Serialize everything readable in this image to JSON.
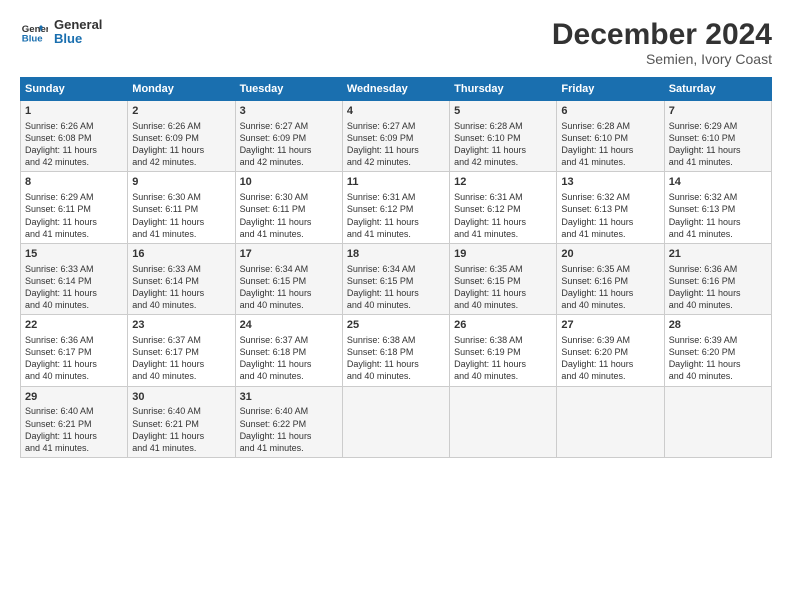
{
  "logo": {
    "line1": "General",
    "line2": "Blue"
  },
  "title": "December 2024",
  "subtitle": "Semien, Ivory Coast",
  "days_of_week": [
    "Sunday",
    "Monday",
    "Tuesday",
    "Wednesday",
    "Thursday",
    "Friday",
    "Saturday"
  ],
  "weeks": [
    [
      {
        "day": "1",
        "lines": [
          "Sunrise: 6:26 AM",
          "Sunset: 6:08 PM",
          "Daylight: 11 hours",
          "and 42 minutes."
        ]
      },
      {
        "day": "2",
        "lines": [
          "Sunrise: 6:26 AM",
          "Sunset: 6:09 PM",
          "Daylight: 11 hours",
          "and 42 minutes."
        ]
      },
      {
        "day": "3",
        "lines": [
          "Sunrise: 6:27 AM",
          "Sunset: 6:09 PM",
          "Daylight: 11 hours",
          "and 42 minutes."
        ]
      },
      {
        "day": "4",
        "lines": [
          "Sunrise: 6:27 AM",
          "Sunset: 6:09 PM",
          "Daylight: 11 hours",
          "and 42 minutes."
        ]
      },
      {
        "day": "5",
        "lines": [
          "Sunrise: 6:28 AM",
          "Sunset: 6:10 PM",
          "Daylight: 11 hours",
          "and 42 minutes."
        ]
      },
      {
        "day": "6",
        "lines": [
          "Sunrise: 6:28 AM",
          "Sunset: 6:10 PM",
          "Daylight: 11 hours",
          "and 41 minutes."
        ]
      },
      {
        "day": "7",
        "lines": [
          "Sunrise: 6:29 AM",
          "Sunset: 6:10 PM",
          "Daylight: 11 hours",
          "and 41 minutes."
        ]
      }
    ],
    [
      {
        "day": "8",
        "lines": [
          "Sunrise: 6:29 AM",
          "Sunset: 6:11 PM",
          "Daylight: 11 hours",
          "and 41 minutes."
        ]
      },
      {
        "day": "9",
        "lines": [
          "Sunrise: 6:30 AM",
          "Sunset: 6:11 PM",
          "Daylight: 11 hours",
          "and 41 minutes."
        ]
      },
      {
        "day": "10",
        "lines": [
          "Sunrise: 6:30 AM",
          "Sunset: 6:11 PM",
          "Daylight: 11 hours",
          "and 41 minutes."
        ]
      },
      {
        "day": "11",
        "lines": [
          "Sunrise: 6:31 AM",
          "Sunset: 6:12 PM",
          "Daylight: 11 hours",
          "and 41 minutes."
        ]
      },
      {
        "day": "12",
        "lines": [
          "Sunrise: 6:31 AM",
          "Sunset: 6:12 PM",
          "Daylight: 11 hours",
          "and 41 minutes."
        ]
      },
      {
        "day": "13",
        "lines": [
          "Sunrise: 6:32 AM",
          "Sunset: 6:13 PM",
          "Daylight: 11 hours",
          "and 41 minutes."
        ]
      },
      {
        "day": "14",
        "lines": [
          "Sunrise: 6:32 AM",
          "Sunset: 6:13 PM",
          "Daylight: 11 hours",
          "and 41 minutes."
        ]
      }
    ],
    [
      {
        "day": "15",
        "lines": [
          "Sunrise: 6:33 AM",
          "Sunset: 6:14 PM",
          "Daylight: 11 hours",
          "and 40 minutes."
        ]
      },
      {
        "day": "16",
        "lines": [
          "Sunrise: 6:33 AM",
          "Sunset: 6:14 PM",
          "Daylight: 11 hours",
          "and 40 minutes."
        ]
      },
      {
        "day": "17",
        "lines": [
          "Sunrise: 6:34 AM",
          "Sunset: 6:15 PM",
          "Daylight: 11 hours",
          "and 40 minutes."
        ]
      },
      {
        "day": "18",
        "lines": [
          "Sunrise: 6:34 AM",
          "Sunset: 6:15 PM",
          "Daylight: 11 hours",
          "and 40 minutes."
        ]
      },
      {
        "day": "19",
        "lines": [
          "Sunrise: 6:35 AM",
          "Sunset: 6:15 PM",
          "Daylight: 11 hours",
          "and 40 minutes."
        ]
      },
      {
        "day": "20",
        "lines": [
          "Sunrise: 6:35 AM",
          "Sunset: 6:16 PM",
          "Daylight: 11 hours",
          "and 40 minutes."
        ]
      },
      {
        "day": "21",
        "lines": [
          "Sunrise: 6:36 AM",
          "Sunset: 6:16 PM",
          "Daylight: 11 hours",
          "and 40 minutes."
        ]
      }
    ],
    [
      {
        "day": "22",
        "lines": [
          "Sunrise: 6:36 AM",
          "Sunset: 6:17 PM",
          "Daylight: 11 hours",
          "and 40 minutes."
        ]
      },
      {
        "day": "23",
        "lines": [
          "Sunrise: 6:37 AM",
          "Sunset: 6:17 PM",
          "Daylight: 11 hours",
          "and 40 minutes."
        ]
      },
      {
        "day": "24",
        "lines": [
          "Sunrise: 6:37 AM",
          "Sunset: 6:18 PM",
          "Daylight: 11 hours",
          "and 40 minutes."
        ]
      },
      {
        "day": "25",
        "lines": [
          "Sunrise: 6:38 AM",
          "Sunset: 6:18 PM",
          "Daylight: 11 hours",
          "and 40 minutes."
        ]
      },
      {
        "day": "26",
        "lines": [
          "Sunrise: 6:38 AM",
          "Sunset: 6:19 PM",
          "Daylight: 11 hours",
          "and 40 minutes."
        ]
      },
      {
        "day": "27",
        "lines": [
          "Sunrise: 6:39 AM",
          "Sunset: 6:20 PM",
          "Daylight: 11 hours",
          "and 40 minutes."
        ]
      },
      {
        "day": "28",
        "lines": [
          "Sunrise: 6:39 AM",
          "Sunset: 6:20 PM",
          "Daylight: 11 hours",
          "and 40 minutes."
        ]
      }
    ],
    [
      {
        "day": "29",
        "lines": [
          "Sunrise: 6:40 AM",
          "Sunset: 6:21 PM",
          "Daylight: 11 hours",
          "and 41 minutes."
        ]
      },
      {
        "day": "30",
        "lines": [
          "Sunrise: 6:40 AM",
          "Sunset: 6:21 PM",
          "Daylight: 11 hours",
          "and 41 minutes."
        ]
      },
      {
        "day": "31",
        "lines": [
          "Sunrise: 6:40 AM",
          "Sunset: 6:22 PM",
          "Daylight: 11 hours",
          "and 41 minutes."
        ]
      },
      null,
      null,
      null,
      null
    ]
  ]
}
